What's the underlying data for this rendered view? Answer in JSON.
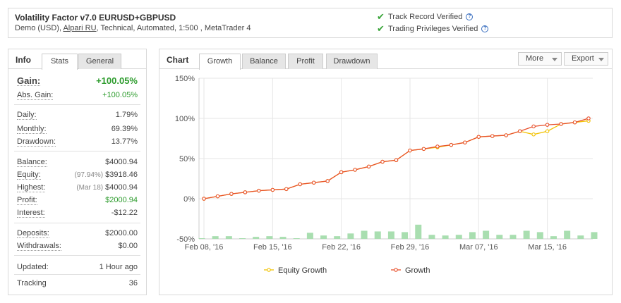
{
  "header": {
    "title": "Volatility Factor v7.0 EURUSD+GBPUSD",
    "subtitle_pre": "Demo (USD), ",
    "broker": "Alpari RU",
    "subtitle_post": ", Technical, Automated, 1:500 , MetaTrader 4",
    "verified": [
      "Track Record Verified",
      "Trading Privileges Verified"
    ]
  },
  "left_panel": {
    "heading": "Info",
    "tabs": [
      "Stats",
      "General"
    ],
    "stats": {
      "gain": {
        "label": "Gain:",
        "value": "+100.05%"
      },
      "abs_gain": {
        "label": "Abs. Gain:",
        "value": "+100.05%"
      },
      "daily": {
        "label": "Daily:",
        "value": "1.79%"
      },
      "monthly": {
        "label": "Monthly:",
        "value": "69.39%"
      },
      "drawdown": {
        "label": "Drawdown:",
        "value": "13.77%"
      },
      "balance": {
        "label": "Balance:",
        "value": "$4000.94"
      },
      "equity": {
        "label": "Equity:",
        "prefix": "(97.94%)",
        "value": "$3918.46"
      },
      "highest": {
        "label": "Highest:",
        "prefix": "(Mar 18)",
        "value": "$4000.94"
      },
      "profit": {
        "label": "Profit:",
        "value": "$2000.94"
      },
      "interest": {
        "label": "Interest:",
        "value": "-$12.22"
      },
      "deposits": {
        "label": "Deposits:",
        "value": "$2000.00"
      },
      "withdrawals": {
        "label": "Withdrawals:",
        "value": "$0.00"
      },
      "updated": {
        "label": "Updated:",
        "value": "1 Hour ago"
      },
      "tracking": {
        "label": "Tracking",
        "value": "36"
      }
    }
  },
  "chart_panel": {
    "heading": "Chart",
    "tabs": [
      "Growth",
      "Balance",
      "Profit",
      "Drawdown"
    ],
    "buttons": {
      "more": "More",
      "export": "Export"
    }
  },
  "colors": {
    "growth": "#e8502c",
    "equity": "#f2c200",
    "bars": "#a9deb0",
    "gain_green": "#2e9c2e",
    "check_green": "#3aa53a"
  },
  "chart_data": {
    "type": "line",
    "ylim": [
      -50,
      150
    ],
    "yticks": [
      "150%",
      "100%",
      "50%",
      "0%",
      "-50%"
    ],
    "ytick_values": [
      150,
      100,
      50,
      0,
      -50
    ],
    "xtick_labels": [
      "Feb 08, '16",
      "Feb 15, '16",
      "Feb 22, '16",
      "Feb 29, '16",
      "Mar 07, '16",
      "Mar 15, '16"
    ],
    "xtick_index": [
      0,
      5,
      10,
      15,
      20,
      25
    ],
    "series": [
      {
        "name": "Growth",
        "values": [
          0,
          3,
          6,
          8,
          10,
          11,
          12,
          18,
          20,
          22,
          33,
          36,
          40,
          46,
          48,
          60,
          62,
          65,
          67,
          70,
          77,
          78,
          79,
          84,
          90,
          92,
          93,
          95,
          100
        ]
      },
      {
        "name": "Equity Growth",
        "values": [
          0,
          3,
          6,
          8,
          10,
          11,
          12,
          18,
          20,
          22,
          33,
          36,
          40,
          46,
          48,
          60,
          62,
          64,
          67,
          70,
          77,
          78,
          79,
          84,
          80,
          84,
          93,
          95,
          97
        ]
      }
    ],
    "bars": [
      1,
      4,
      4,
      1,
      3,
      4,
      3,
      1,
      9,
      5,
      4,
      8,
      12,
      11,
      11,
      10,
      21,
      6,
      5,
      6,
      10,
      12,
      6,
      6,
      12,
      10,
      4,
      12,
      5,
      10
    ]
  }
}
